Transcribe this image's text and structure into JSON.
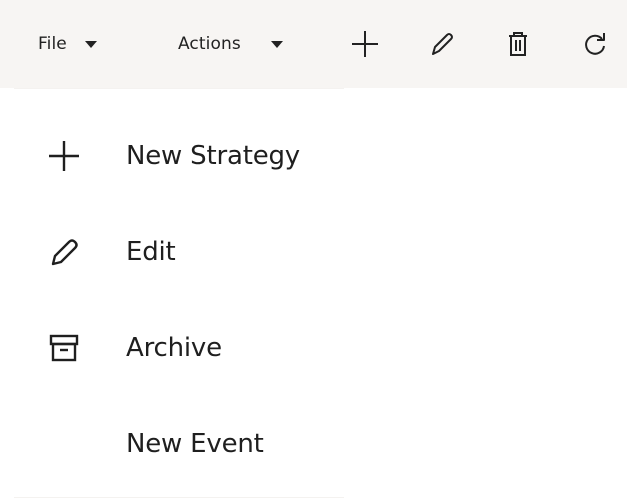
{
  "toolbar": {
    "file_label": "File",
    "actions_label": "Actions",
    "icons": {
      "add": "plus-icon",
      "edit": "pencil-icon",
      "delete": "trash-icon",
      "refresh": "refresh-icon"
    }
  },
  "menu": {
    "items": [
      {
        "label": "New Strategy",
        "icon": "plus-icon"
      },
      {
        "label": "Edit",
        "icon": "pencil-icon"
      },
      {
        "label": "Archive",
        "icon": "archive-box-icon"
      },
      {
        "label": "New Event",
        "icon": ""
      }
    ]
  }
}
